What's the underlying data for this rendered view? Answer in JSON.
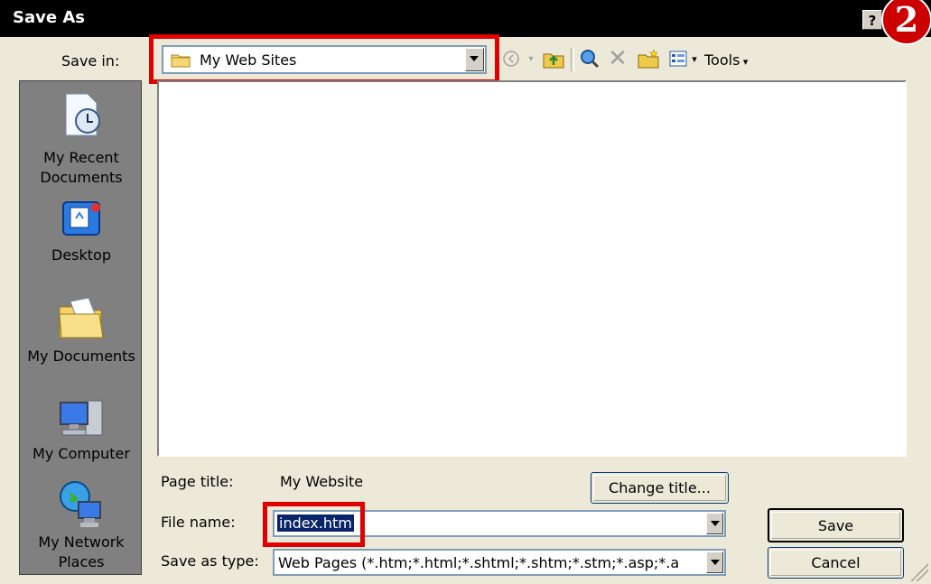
{
  "window": {
    "title": "Save As",
    "help_label": "?"
  },
  "step_badge": "2",
  "save_in": {
    "label": "Save in:",
    "value": "My Web Sites"
  },
  "toolbar": {
    "tools_label": "Tools"
  },
  "places": [
    {
      "label_line1": "My Recent",
      "label_line2": "Documents",
      "icon": "recent-documents-icon"
    },
    {
      "label_line1": "Desktop",
      "label_line2": "",
      "icon": "desktop-icon"
    },
    {
      "label_line1": "My Documents",
      "label_line2": "",
      "icon": "my-documents-icon"
    },
    {
      "label_line1": "My Computer",
      "label_line2": "",
      "icon": "my-computer-icon"
    },
    {
      "label_line1": "My Network",
      "label_line2": "Places",
      "icon": "my-network-places-icon"
    }
  ],
  "page_title": {
    "label": "Page title:",
    "value": "My Website",
    "change_button": "Change title..."
  },
  "file_name": {
    "label": "File name:",
    "value": "index.htm"
  },
  "save_as_type": {
    "label": "Save as type:",
    "value": "Web Pages (*.htm;*.html;*.shtml;*.shtm;*.stm;*.asp;*.a"
  },
  "buttons": {
    "save": "Save",
    "cancel": "Cancel"
  },
  "colors": {
    "highlight": "#e00000",
    "dialog_bg": "#ece9d8",
    "selection": "#0a246a",
    "badge": "#cc0000"
  }
}
